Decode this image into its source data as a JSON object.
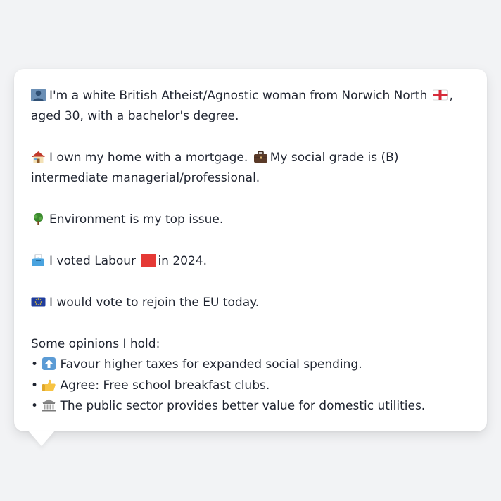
{
  "profile": {
    "identity": {
      "icon": "person-silhouette-icon",
      "text_before_flag": "I'm a white British Atheist/Agnostic woman from Norwich North",
      "flag": "england-flag-icon",
      "text_after_flag": ", aged 30, with a bachelor's degree."
    },
    "housing": {
      "icon": "house-icon",
      "text": "I own my home with a mortgage.",
      "work_icon": "briefcase-icon",
      "text2": "My social grade is (B) intermediate managerial/professional."
    },
    "issue": {
      "icon": "tree-icon",
      "text": "Environment is my top issue."
    },
    "vote": {
      "icon": "ballot-box-icon",
      "text_before_party": "I voted Labour",
      "party_icon": "red-square-icon",
      "party_color": "#e53935",
      "text_after_party": "in 2024."
    },
    "eu": {
      "icon": "eu-flag-icon",
      "text": "I would vote to rejoin the EU today."
    }
  },
  "opinions": {
    "heading": "Some opinions I hold:",
    "bullet": "•",
    "items": [
      {
        "icon": "up-arrow-icon",
        "text": "Favour higher taxes for expanded social spending."
      },
      {
        "icon": "thumbs-up-icon",
        "text": "Agree: Free school breakfast clubs."
      },
      {
        "icon": "classical-building-icon",
        "text": "The public sector provides better value for domestic utilities."
      }
    ]
  }
}
